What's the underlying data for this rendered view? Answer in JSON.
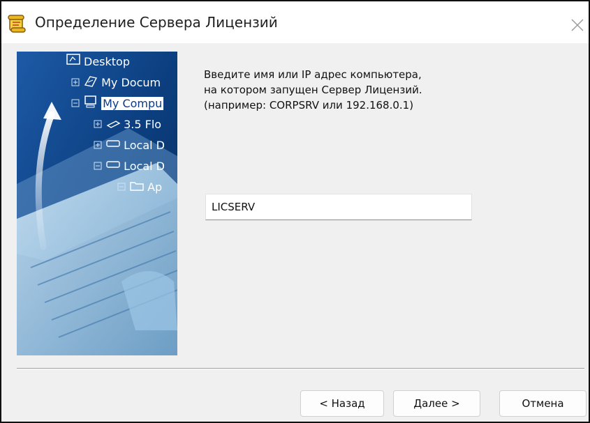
{
  "window": {
    "title": "Определение Сервера Лицензий",
    "close_icon": "close-icon",
    "app_icon": "license-scroll-icon"
  },
  "side_image": {
    "tree": [
      {
        "label": "Desktop",
        "icon": "desktop-icon"
      },
      {
        "label": "My Docum",
        "icon": "my-documents-icon"
      },
      {
        "label": "My Compu",
        "icon": "my-computer-icon",
        "selected": true
      },
      {
        "label": "3.5 Flo",
        "icon": "floppy-drive-icon"
      },
      {
        "label": "Local D",
        "icon": "local-drive-icon"
      },
      {
        "label": "Local D",
        "icon": "local-drive-icon"
      },
      {
        "label": "Ap",
        "icon": "folder-icon"
      }
    ]
  },
  "prompt": {
    "line1": "Введите имя или IP адрес компьютера,",
    "line2": "на котором запущен Сервер Лицензий.",
    "line3": "(например: CORPSRV или 192.168.0.1)"
  },
  "server_field": {
    "value": "LICSERV"
  },
  "buttons": {
    "back": "< Назад",
    "next": "Далее >",
    "cancel": "Отмена"
  }
}
